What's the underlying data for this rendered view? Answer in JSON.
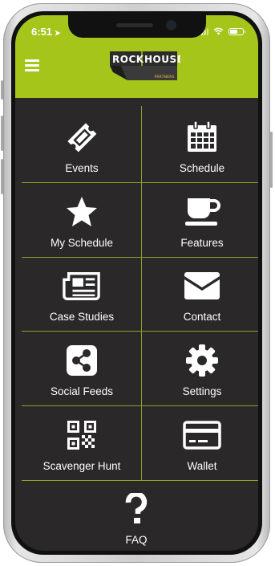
{
  "status_bar": {
    "time": "6:51",
    "location_arrow": "location-arrow-icon"
  },
  "header": {
    "logo_word_1": "ROCK",
    "logo_word_2": "HOUSE",
    "logo_tagline": "PARTNERS",
    "accent_color": "#a6c51a"
  },
  "menu": {
    "items": [
      {
        "label": "Events",
        "icon": "ticket-icon"
      },
      {
        "label": "Schedule",
        "icon": "calendar-icon"
      },
      {
        "label": "My Schedule",
        "icon": "star-icon"
      },
      {
        "label": "Features",
        "icon": "coffee-cup-icon"
      },
      {
        "label": "Case Studies",
        "icon": "newspaper-icon"
      },
      {
        "label": "Contact",
        "icon": "envelope-icon"
      },
      {
        "label": "Social Feeds",
        "icon": "share-icon"
      },
      {
        "label": "Settings",
        "icon": "gear-icon"
      },
      {
        "label": "Scavenger Hunt",
        "icon": "qr-code-icon"
      },
      {
        "label": "Wallet",
        "icon": "credit-card-icon"
      },
      {
        "label": "FAQ",
        "icon": "question-mark-icon"
      }
    ]
  },
  "colors": {
    "background": "#2a2828",
    "divider": "#8fa028",
    "text": "#ffffff"
  }
}
